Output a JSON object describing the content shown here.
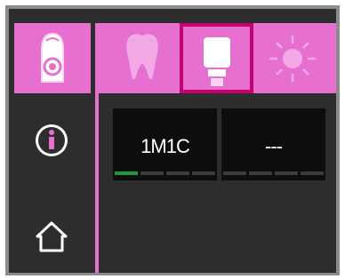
{
  "colors": {
    "accent_pink": "#e66fd0",
    "active_border": "#c8006f",
    "progress_green": "#1a9a3d",
    "panel_dark": "#2d2d2d",
    "box_black": "#0d0d0d"
  },
  "left_nav": {
    "device_icon": "curing-light-device-icon",
    "info_icon": "info-icon",
    "home_icon": "home-icon"
  },
  "top_bar": {
    "tabs": [
      {
        "name": "tooth-icon",
        "active": false
      },
      {
        "name": "shade-tube-icon",
        "active": true
      },
      {
        "name": "light-burst-icon",
        "active": false
      }
    ]
  },
  "shade_slots": [
    {
      "label": "1M1C",
      "progress_segments_filled": 1,
      "progress_segments_total": 4
    },
    {
      "label": "---",
      "progress_segments_filled": 0,
      "progress_segments_total": 4
    }
  ]
}
